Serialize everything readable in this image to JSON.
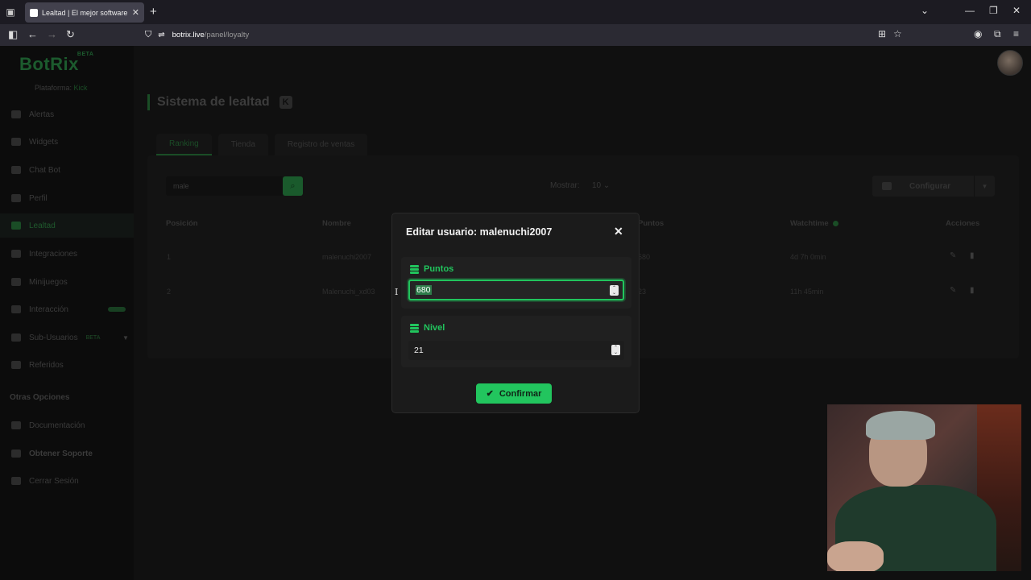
{
  "browser": {
    "tab_title": "Lealtad | El mejor software para",
    "url_domain": "botrix.live",
    "url_path": "/panel/loyalty"
  },
  "sidebar": {
    "logo": "BotRix",
    "logo_badge": "BETA",
    "platform_label": "Plataforma:",
    "platform_value": "Kick",
    "items": [
      {
        "label": "Alertas"
      },
      {
        "label": "Widgets"
      },
      {
        "label": "Chat Bot"
      },
      {
        "label": "Perfil"
      },
      {
        "label": "Lealtad"
      },
      {
        "label": "Integraciones"
      },
      {
        "label": "Minijuegos"
      },
      {
        "label": "Interacción"
      },
      {
        "label": "Sub-Usuarios",
        "tag": "BETA"
      },
      {
        "label": "Referidos"
      }
    ],
    "section_title": "Otras Opciones",
    "other_items": [
      {
        "label": "Documentación"
      },
      {
        "label": "Obtener Soporte"
      },
      {
        "label": "Cerrar Sesión"
      }
    ]
  },
  "main": {
    "title": "Sistema de lealtad",
    "tabs": [
      "Ranking",
      "Tienda",
      "Registro de ventas"
    ],
    "search_value": "male",
    "show_label": "Mostrar:",
    "show_value": "10",
    "config_label": "Configurar",
    "table": {
      "headers": [
        "Posición",
        "Nombre",
        "Puntos",
        "Watchtime",
        "Acciones"
      ],
      "rows": [
        {
          "pos": "1",
          "name": "malenuchi2007",
          "points": "680",
          "watchtime": "4d 7h 0min"
        },
        {
          "pos": "2",
          "name": "Malenuchi_xd03",
          "points": "23",
          "watchtime": "11h 45min"
        }
      ]
    }
  },
  "modal": {
    "title": "Editar usuario: malenuchi2007",
    "points_label": "Puntos",
    "points_value": "680",
    "level_label": "Nivel",
    "level_value": "21",
    "confirm_label": "Confirmar"
  },
  "colors": {
    "accent": "#21c55d",
    "background": "#101010",
    "modal_bg": "#1b1b1b"
  }
}
